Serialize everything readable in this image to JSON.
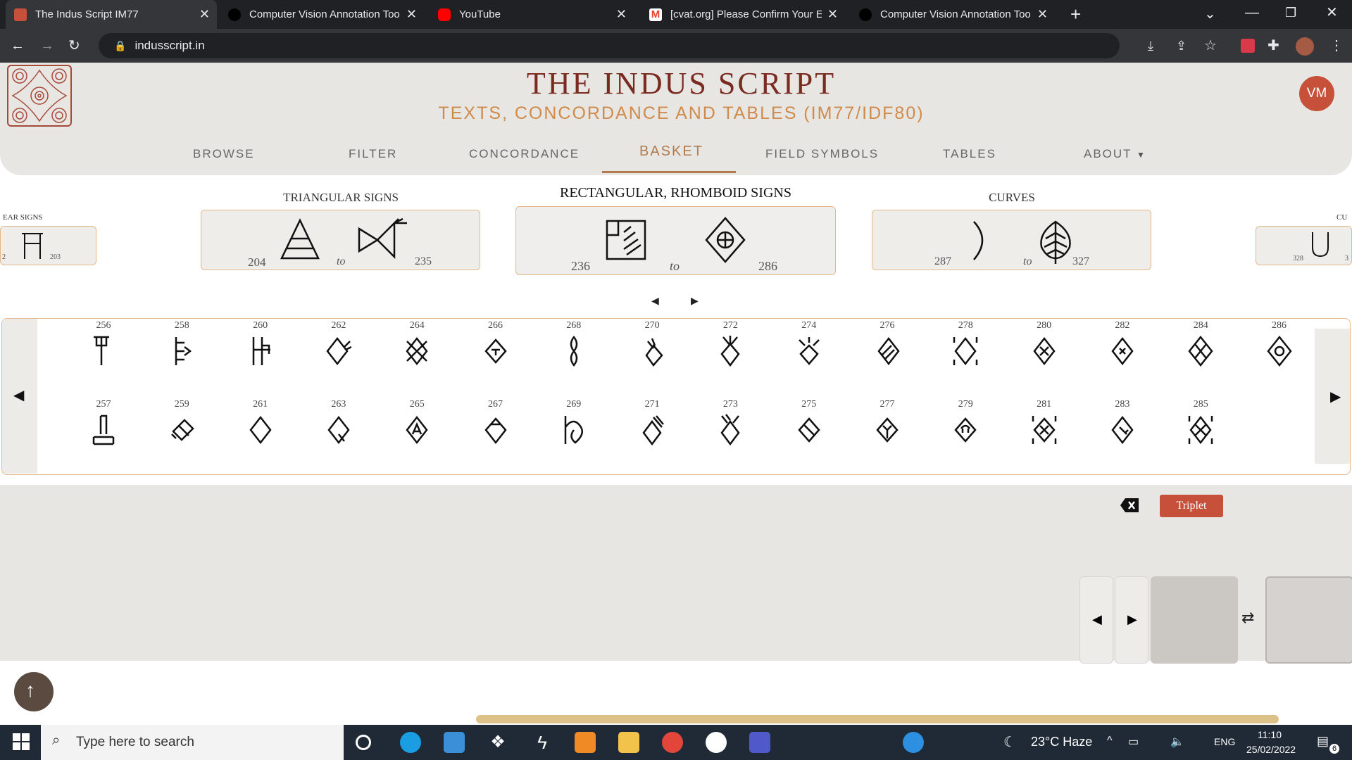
{
  "browser": {
    "tabs": [
      {
        "title": "The Indus Script IM77",
        "favicon_color": "#c6503a"
      },
      {
        "title": "Computer Vision Annotation Too",
        "favicon_color": "#444444"
      },
      {
        "title": "YouTube",
        "favicon_color": "#ff0000"
      },
      {
        "title": "[cvat.org] Please Confirm Your E",
        "favicon_color": "#ea4335"
      },
      {
        "title": "Computer Vision Annotation Too",
        "favicon_color": "#444444"
      }
    ],
    "url": "indusscript.in"
  },
  "header": {
    "title": "THE INDUS SCRIPT",
    "subtitle": "TEXTS, CONCORDANCE AND TABLES (IM77/IDF80)",
    "avatar": "VM"
  },
  "nav": [
    "BROWSE",
    "FILTER",
    "CONCORDANCE",
    "BASKET",
    "FIELD SYMBOLS",
    "TABLES",
    "ABOUT"
  ],
  "categories": {
    "prev": {
      "label": "EAR SIGNS",
      "from": "2",
      "to": "203"
    },
    "triangular": {
      "label": "TRIANGULAR SIGNS",
      "from": "204",
      "to_word": "to",
      "to": "235"
    },
    "rect": {
      "label": "RECTANGULAR, RHOMBOID SIGNS",
      "from": "236",
      "to_word": "to",
      "to": "286"
    },
    "curves": {
      "label": "CURVES",
      "from": "287",
      "to_word": "to",
      "to": "327"
    },
    "next": {
      "label": "CU",
      "from": "328",
      "to": "3"
    }
  },
  "signs_top": [
    "256",
    "258",
    "260",
    "262",
    "264",
    "266",
    "268",
    "270",
    "272",
    "274",
    "276",
    "278",
    "280",
    "282",
    "284",
    "286"
  ],
  "signs_bottom": [
    "257",
    "259",
    "261",
    "263",
    "265",
    "267",
    "269",
    "271",
    "273",
    "275",
    "277",
    "279",
    "281",
    "283",
    "285"
  ],
  "basket": {
    "triplet_label": "Triplet"
  },
  "taskbar": {
    "search_placeholder": "Type here to search",
    "weather": "23°C  Haze",
    "lang": "ENG",
    "time": "11:10",
    "date": "25/02/2022",
    "notif": "6"
  }
}
